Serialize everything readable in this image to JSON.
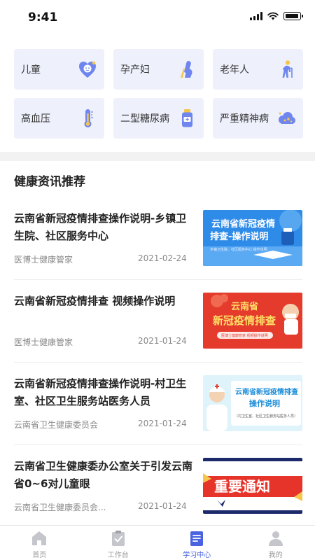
{
  "status_bar": {
    "time": "9:41"
  },
  "categories": [
    {
      "label": "儿童",
      "icon": "baby-heart-icon"
    },
    {
      "label": "孕产妇",
      "icon": "pregnant-woman-icon"
    },
    {
      "label": "老年人",
      "icon": "elderly-person-icon"
    },
    {
      "label": "高血压",
      "icon": "thermometer-icon"
    },
    {
      "label": "二型糖尿病",
      "icon": "medicine-bottle-icon"
    },
    {
      "label": "严重精神病",
      "icon": "cloud-brain-icon"
    }
  ],
  "section": {
    "title": "健康资讯推荐"
  },
  "news": [
    {
      "title": "云南省新冠疫情排查操作说明-乡镇卫生院、社区服务中心",
      "source": "医博士健康管家",
      "date": "2021-02-24",
      "thumb_text": "云南省新冠疫情排查-操作说明",
      "thumb_sub": "乡镇卫生院、社区服务中心 操作说明"
    },
    {
      "title": "云南省新冠疫情排查 视频操作说明",
      "source": "医博士健康管家",
      "date": "2021-01-24",
      "thumb_text_1": "云南省",
      "thumb_text_2": "新冠疫情排查",
      "thumb_sub": "医博士健康管家 视频操作说明"
    },
    {
      "title": "云南省新冠疫情排查操作说明-村卫生室、社区卫生服务站医务人员",
      "source": "云南省卫生健康委员会",
      "date": "2021-01-24",
      "thumb_text_1": "云南省新冠疫情排查",
      "thumb_text_2": "操作说明",
      "thumb_sub": "（村卫生室、社区卫生服务站医务人员）"
    },
    {
      "title": "云南省卫生健康委办公室关于引发云南省0~6对儿童眼",
      "source": "云南省卫生健康委员会...",
      "date": "2021-01-24",
      "thumb_text": "重要通知"
    }
  ],
  "tabs": [
    {
      "label": "首页",
      "icon": "home-icon",
      "active": false
    },
    {
      "label": "工作台",
      "icon": "clipboard-check-icon",
      "active": false
    },
    {
      "label": "学习中心",
      "icon": "document-icon",
      "active": true
    },
    {
      "label": "我的",
      "icon": "person-icon",
      "active": false
    }
  ],
  "colors": {
    "accent": "#4a63e0",
    "card_bg": "#eef0fc",
    "icon_blue": "#6f86ee",
    "icon_yellow": "#f5c64b"
  }
}
